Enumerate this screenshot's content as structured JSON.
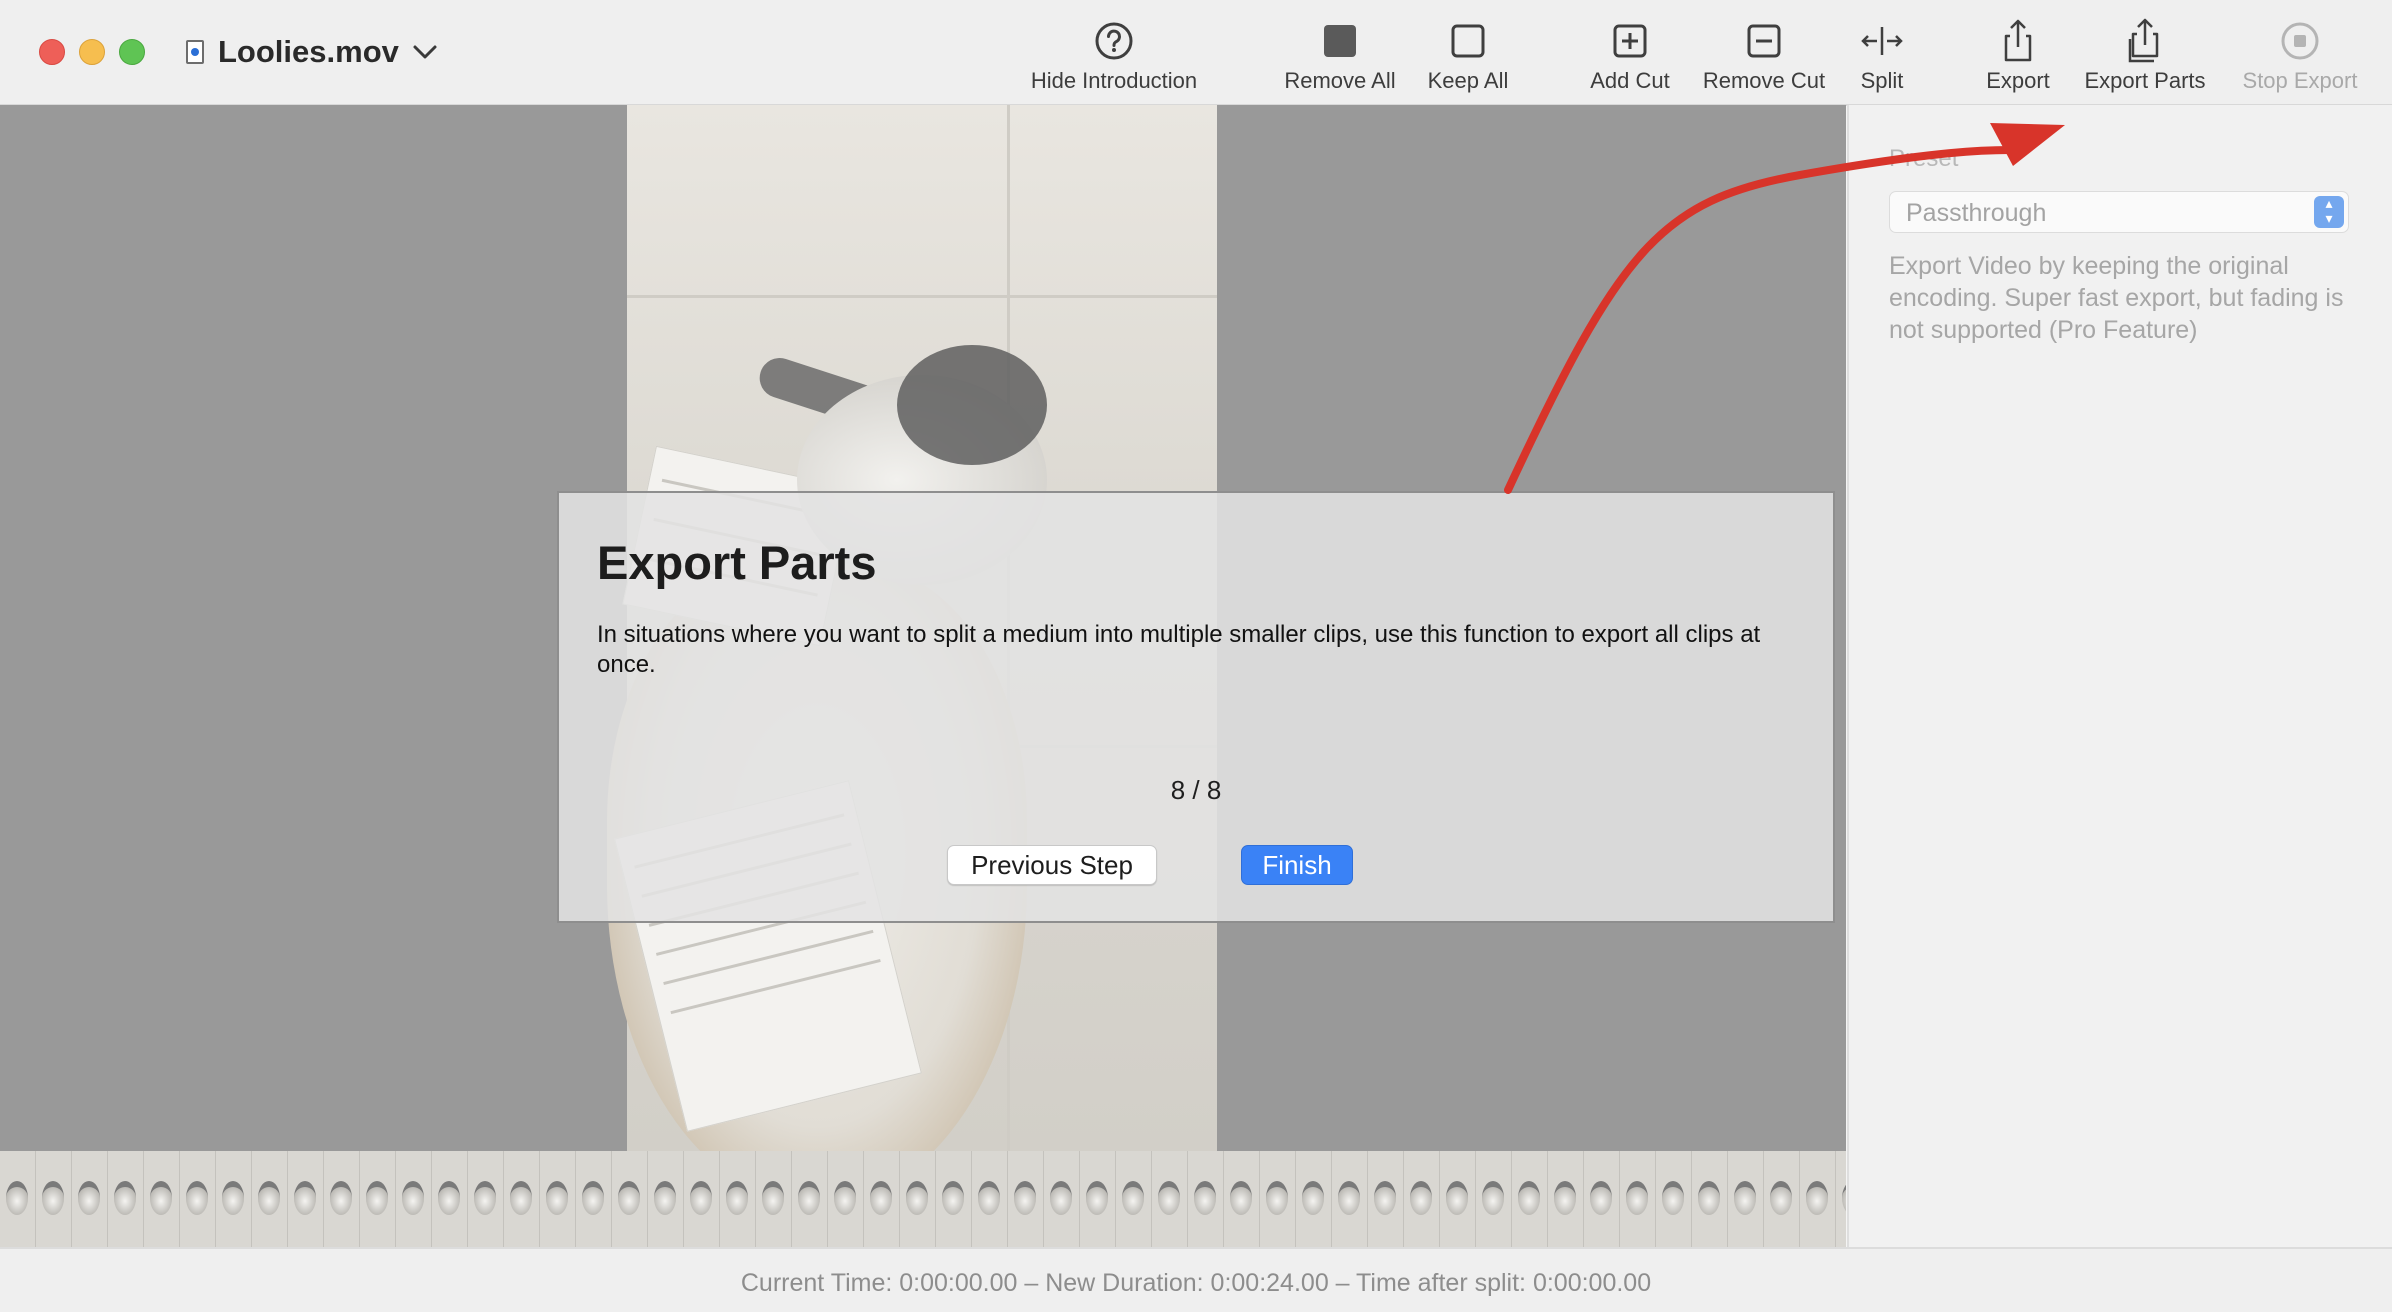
{
  "window": {
    "document_title": "Loolies.mov",
    "accent_color": "#3a82f6"
  },
  "toolbar": {
    "items": [
      {
        "label": "Hide Introduction",
        "icon": "question-circle-icon"
      },
      {
        "label": "Remove All",
        "icon": "filled-square-icon"
      },
      {
        "label": "Keep All",
        "icon": "empty-square-icon"
      },
      {
        "label": "Add Cut",
        "icon": "plus-square-icon"
      },
      {
        "label": "Remove Cut",
        "icon": "minus-square-icon"
      },
      {
        "label": "Split",
        "icon": "split-arrows-icon"
      },
      {
        "label": "Export",
        "icon": "share-icon"
      },
      {
        "label": "Export Parts",
        "icon": "share-multiple-icon"
      },
      {
        "label": "Stop Export",
        "icon": "stop-circle-icon",
        "disabled": true
      }
    ]
  },
  "inspector": {
    "preset_label": "Preset",
    "preset_value": "Passthrough",
    "description": "Export Video by keeping the original encoding. Super fast export, but fading is not supported (Pro Feature)"
  },
  "dialog": {
    "title": "Export Parts",
    "body": "In situations where you want to split a medium into multiple smaller clips, use this function to export all clips at once.",
    "step": "8 / 8",
    "previous_label": "Previous Step",
    "finish_label": "Finish"
  },
  "status": {
    "text": "Current Time: 0:00:00.00 – New Duration: 0:00:24.00 – Time after split: 0:00:00.00"
  },
  "annotation": {
    "arrow_color": "#d8342a"
  }
}
